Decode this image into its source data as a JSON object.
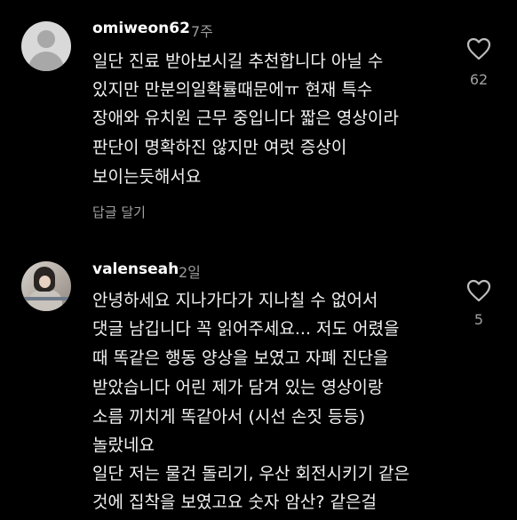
{
  "comments": [
    {
      "username": "omiweon62",
      "time_ago": "7주",
      "lines": [
        "일단 진료 받아보시길 추천합니다 아닐 수",
        "있지만 만분의일확률때문에ㅠ 현재 특수",
        "장애와 유치원 근무 중입니다  짧은 영상이라",
        "판단이 명확하진 않지만 여럿 증상이",
        "보이는듯해서요"
      ],
      "reply_label": "답글 달기",
      "like_count": "62",
      "avatar": "default-avatar-icon"
    },
    {
      "username": "valenseah",
      "time_ago": "2일",
      "lines": [
        "안녕하세요 지나가다가 지나칠 수 없어서",
        "댓글 남깁니다 꼭 읽어주세요... 저도 어렸을",
        "때 똑같은 행동 양상을 보였고 자폐 진단을",
        "받았습니다 어린 제가 담겨 있는 영상이랑",
        "소름 끼치게 똑같아서 (시선 손짓 등등)",
        "놀랐네요",
        "일단 저는 물건 돌리기, 우산 회전시키기 같은",
        "것에 집착을 보였고요 숫자 암산? 같은걸"
      ],
      "like_count": "5",
      "avatar": "profile-photo"
    }
  ],
  "colors": {
    "background": "#000000",
    "text": "#f2f2f2",
    "secondary": "#9a9a9a"
  }
}
